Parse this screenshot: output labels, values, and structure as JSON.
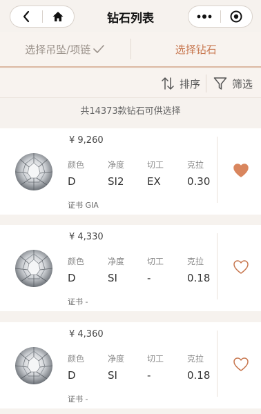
{
  "header": {
    "title": "钻石列表",
    "back_icon": "chevron-left-icon",
    "home_icon": "home-icon",
    "more_icon": "more-dots-icon",
    "target_icon": "target-icon"
  },
  "steps": [
    {
      "label": "选择吊坠/项链",
      "done": true
    },
    {
      "label": "选择钻石",
      "active": true
    }
  ],
  "toolbar": {
    "sort_label": "排序",
    "filter_label": "筛选"
  },
  "summary": {
    "count_text": "共14373款钻石可供选择"
  },
  "diamonds": [
    {
      "price": "¥ 9,260",
      "labels": {
        "color": "颜色",
        "clarity": "净度",
        "cut": "切工",
        "carat": "克拉"
      },
      "color": "D",
      "clarity": "SI2",
      "cut": "EX",
      "carat": "0.30",
      "cert_label": "证书",
      "cert": "GIA",
      "favorited": true
    },
    {
      "price": "¥ 4,330",
      "labels": {
        "color": "颜色",
        "clarity": "净度",
        "cut": "切工",
        "carat": "克拉"
      },
      "color": "D",
      "clarity": "SI",
      "cut": "-",
      "carat": "0.18",
      "cert_label": "证书",
      "cert": "-",
      "favorited": false
    },
    {
      "price": "¥ 4,360",
      "labels": {
        "color": "颜色",
        "clarity": "净度",
        "cut": "切工",
        "carat": "克拉"
      },
      "color": "D",
      "clarity": "SI",
      "cut": "-",
      "carat": "0.18",
      "cert_label": "证书",
      "cert": "-",
      "favorited": false
    }
  ],
  "colors": {
    "accent": "#c7764e",
    "heart_filled": "#d9865e",
    "background": "#f6f2ee"
  }
}
